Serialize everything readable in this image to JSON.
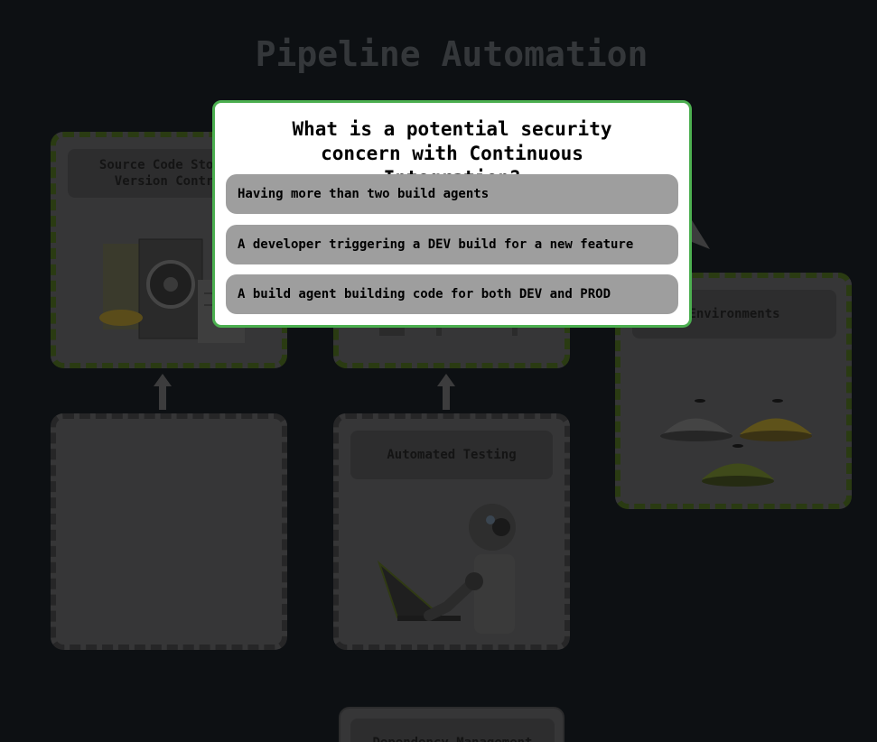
{
  "page": {
    "title": "Pipeline Automation"
  },
  "cards": {
    "source_code": {
      "label": "Source Code Storage\nVersion Control"
    },
    "environments": {
      "label": "Environments"
    },
    "automated_testing": {
      "label": "Automated Testing"
    },
    "dependency": {
      "label": "Dependency Management"
    }
  },
  "quiz": {
    "question": "What is a potential security concern with Continuous Integration?",
    "options": [
      "Having more than two build agents",
      "A developer triggering a DEV build for a new feature",
      "A build agent building code for both DEV and PROD"
    ]
  },
  "colors": {
    "modal_border": "#4caf50",
    "option_bg": "#9e9e9e",
    "background": "#0d1013"
  }
}
